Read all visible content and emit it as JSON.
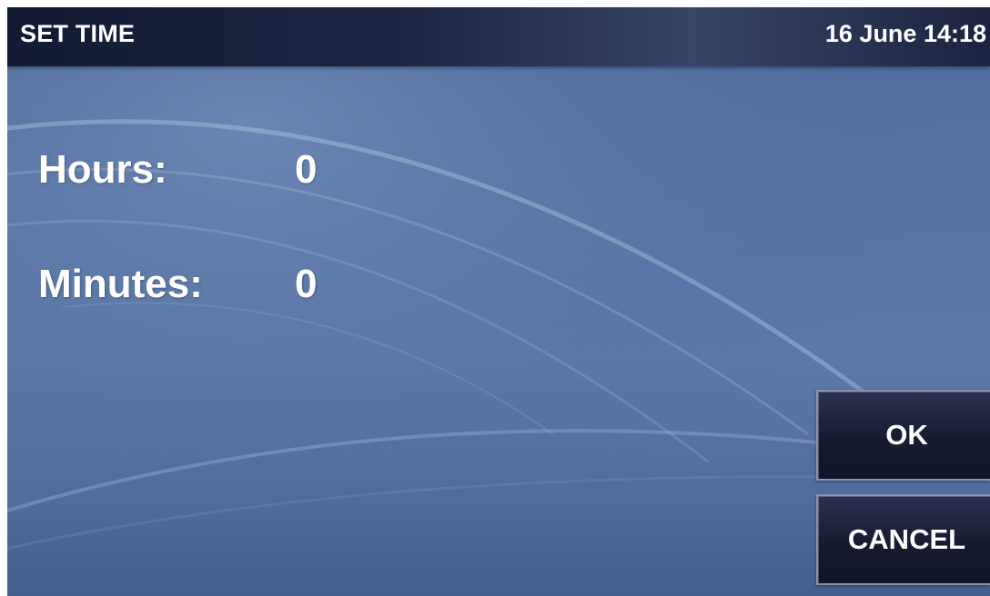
{
  "header": {
    "title": "SET TIME",
    "datetime": "16 June 14:18"
  },
  "fields": {
    "hours": {
      "label": "Hours:",
      "value": "0"
    },
    "minutes": {
      "label": "Minutes:",
      "value": "0"
    }
  },
  "buttons": {
    "ok": "OK",
    "cancel": "CANCEL"
  },
  "colors": {
    "background": "#5775a4",
    "header": "#1b2542",
    "button": "#161b31",
    "text": "#ffffff"
  }
}
